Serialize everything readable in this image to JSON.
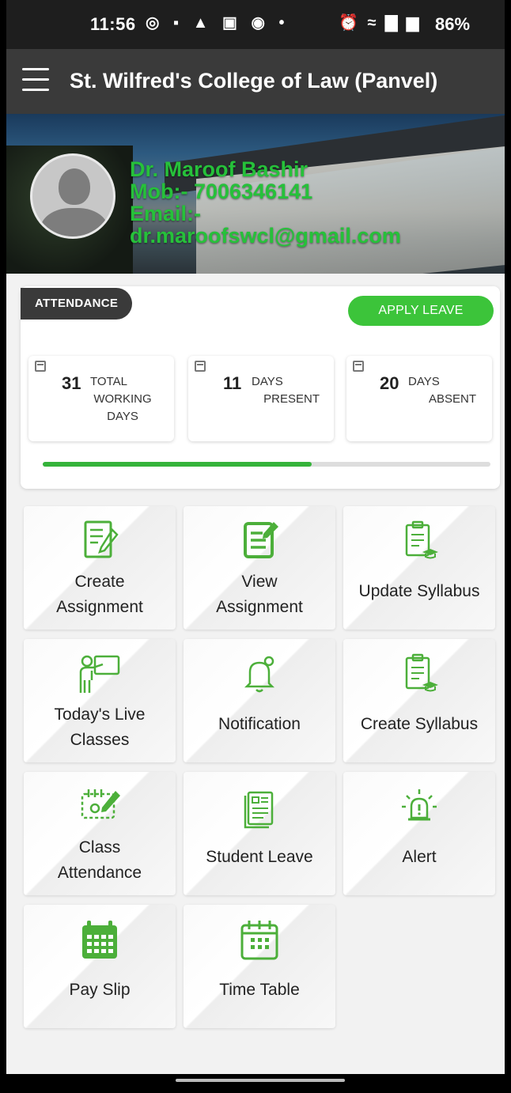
{
  "status_bar": {
    "time": "11:56",
    "notification_icons": "◎ ▪ ▲ ▣ ◉ •",
    "system_icons": "⏰ ≈ ▇ ▆",
    "battery": "86%"
  },
  "app_bar": {
    "title": "St. Wilfred's College of Law (Panvel)"
  },
  "profile": {
    "name": "Dr. Maroof Bashir",
    "mobile": "Mob:- 7006346141",
    "email_label": "Email:-",
    "email": "dr.maroofswcl@gmail.com"
  },
  "attendance": {
    "label": "ATTENDANCE",
    "apply_leave": "APPLY LEAVE",
    "stats": [
      {
        "value": "31",
        "label_line1": "TOTAL",
        "label_line2": "WORKING",
        "label_line3": "DAYS"
      },
      {
        "value": "11",
        "label_line1": "DAYS",
        "label_line2": "PRESENT"
      },
      {
        "value": "20",
        "label_line1": "DAYS",
        "label_line2": "ABSENT"
      }
    ],
    "progress_fraction": 0.6
  },
  "menu": [
    {
      "line1": "Create",
      "line2": "Assignment"
    },
    {
      "line1": "View",
      "line2": "Assignment"
    },
    {
      "line1": "Update Syllabus"
    },
    {
      "line1": "Today's Live",
      "line2": "Classes"
    },
    {
      "line1": "Notification"
    },
    {
      "line1": "Create Syllabus"
    },
    {
      "line1": "Class",
      "line2": "Attendance"
    },
    {
      "line1": "Student Leave"
    },
    {
      "line1": "Alert"
    },
    {
      "line1": "Pay Slip"
    },
    {
      "line1": "Time Table"
    }
  ],
  "colors": {
    "accent_green": "#3cc43a",
    "icon_green": "#4caf3a",
    "app_bar": "#3a3a3a"
  }
}
